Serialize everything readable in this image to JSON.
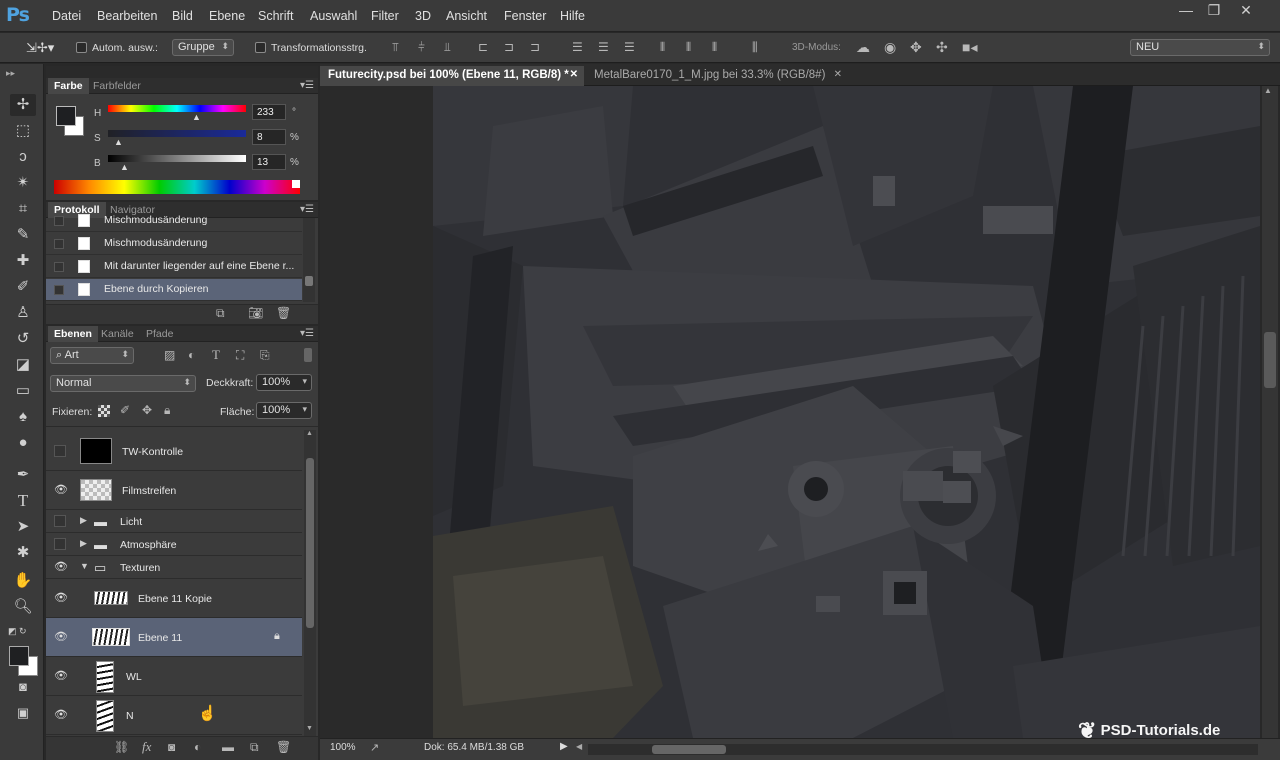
{
  "app": {
    "logo": "Ps",
    "window_controls": [
      "—",
      "❐",
      "✕"
    ]
  },
  "menu": [
    "Datei",
    "Bearbeiten",
    "Bild",
    "Ebene",
    "Schrift",
    "Auswahl",
    "Filter",
    "3D",
    "Ansicht",
    "Fenster",
    "Hilfe"
  ],
  "options": {
    "auto_select_label": "Autom. ausw.:",
    "auto_select_value": "Gruppe",
    "transform_label": "Transformationsstrg.",
    "mode_3d_label": "3D-Modus:",
    "workspace": "NEU"
  },
  "color_panel": {
    "tabs": [
      "Farbe",
      "Farbfelder"
    ],
    "sliders": [
      {
        "label": "H",
        "value": "233",
        "unit": "°",
        "pos": 0.62
      },
      {
        "label": "S",
        "value": "8",
        "unit": "%",
        "pos": 0.08
      },
      {
        "label": "B",
        "value": "13",
        "unit": "%",
        "pos": 0.13
      }
    ]
  },
  "history_panel": {
    "tabs": [
      "Protokoll",
      "Navigator"
    ],
    "items": [
      {
        "label": "Mischmodusänderung",
        "selected": false
      },
      {
        "label": "Mischmodusänderung",
        "selected": false
      },
      {
        "label": "Mit darunter liegender auf eine Ebene r...",
        "selected": false
      },
      {
        "label": "Ebene durch Kopieren",
        "selected": true
      }
    ]
  },
  "layers_panel": {
    "tabs": [
      "Ebenen",
      "Kanäle",
      "Pfade"
    ],
    "filter": "Art",
    "blend_mode": "Normal",
    "opacity_label": "Deckkraft:",
    "opacity": "100%",
    "lock_label": "Fixieren:",
    "fill_label": "Fläche:",
    "fill": "100%",
    "layers": [
      {
        "name": "TW-Kontrolle",
        "visible": false,
        "kind": "black"
      },
      {
        "name": "Filmstreifen",
        "visible": true,
        "kind": "checker"
      },
      {
        "name": "Licht",
        "visible": false,
        "kind": "group"
      },
      {
        "name": "Atmosphäre",
        "visible": false,
        "kind": "group"
      },
      {
        "name": "Texturen",
        "visible": true,
        "kind": "group-open"
      },
      {
        "name": "Ebene 11 Kopie",
        "visible": true,
        "kind": "texture"
      },
      {
        "name": "Ebene 11",
        "visible": true,
        "kind": "texture",
        "selected": true
      },
      {
        "name": "WL",
        "visible": true,
        "kind": "mask"
      },
      {
        "name": "N",
        "visible": true,
        "kind": "mask"
      }
    ]
  },
  "documents": [
    {
      "title": "Futurecity.psd bei 100% (Ebene 11, RGB/8) *",
      "active": true
    },
    {
      "title": "MetalBare0170_1_M.jpg bei 33.3% (RGB/8#)",
      "active": false
    }
  ],
  "status": {
    "zoom": "100%",
    "doc": "Dok: 65.4 MB/1.38 GB"
  },
  "watermark": "PSD-Tutorials.de"
}
